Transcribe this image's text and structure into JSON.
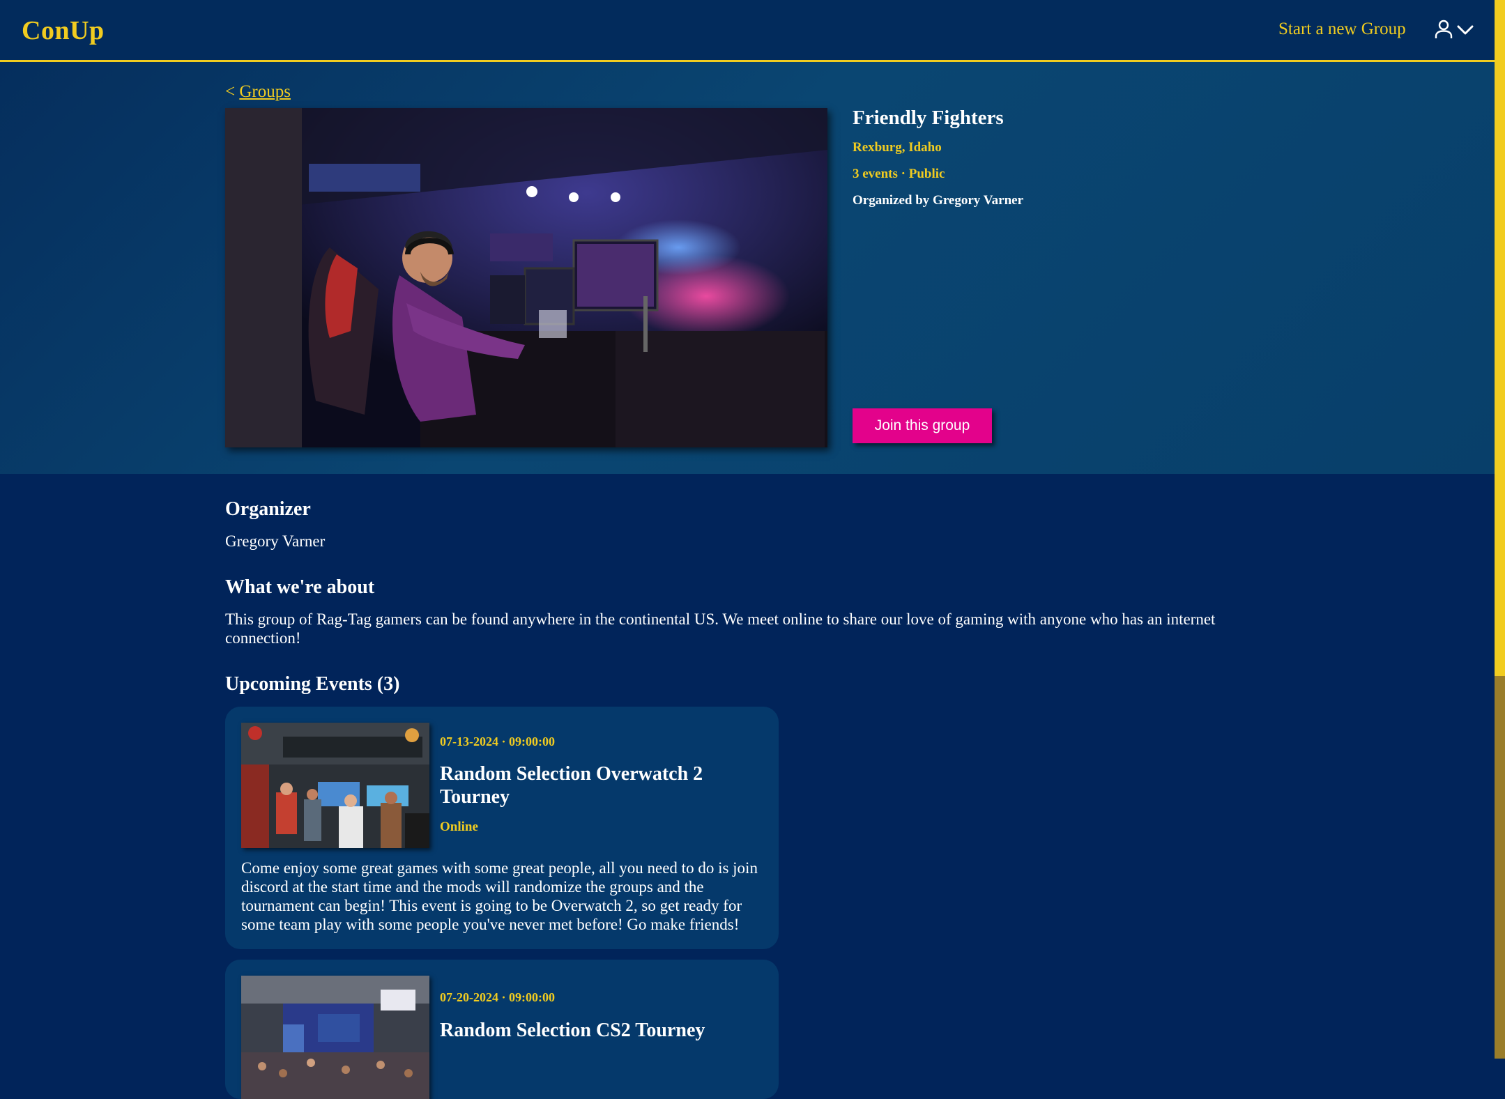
{
  "header": {
    "logo": "ConUp",
    "start_group_label": "Start a new Group",
    "user_icon": "user-icon",
    "chevron_icon": "chevron-down-icon"
  },
  "breadcrumb": {
    "prefix": "<",
    "link": "Groups"
  },
  "group": {
    "name": "Friendly Fighters",
    "location": "Rexburg, Idaho",
    "meta": "3 events · Public",
    "organized_by": "Organized by Gregory Varner",
    "join_label": "Join this group",
    "image_icon": "esports-arena-photo"
  },
  "organizer": {
    "heading": "Organizer",
    "name": "Gregory Varner"
  },
  "about": {
    "heading": "What we're about",
    "text": "This group of Rag-Tag gamers can be found anywhere in the continental US. We meet online to share our love of gaming with anyone who has an internet connection!"
  },
  "events": {
    "heading": "Upcoming Events (3)",
    "items": [
      {
        "date": "07-13-2024 · 09:00:00",
        "title": "Random Selection Overwatch 2 Tourney",
        "venue": "Online",
        "description": "Come enjoy some great games with some great people, all you need to do is join discord at the start time and the mods will randomize the groups and the tournament can begin! This event is going to be Overwatch 2, so get ready for some team play with some people you've never met before! Go make friends!"
      },
      {
        "date": "07-20-2024 · 09:00:00",
        "title": "Random Selection CS2 Tourney",
        "venue": "",
        "description": ""
      }
    ]
  },
  "colors": {
    "accent": "#f1cc20",
    "background": "#01245a",
    "hero": "#0a4672",
    "card": "#05396b",
    "join_button": "#e3028b"
  }
}
